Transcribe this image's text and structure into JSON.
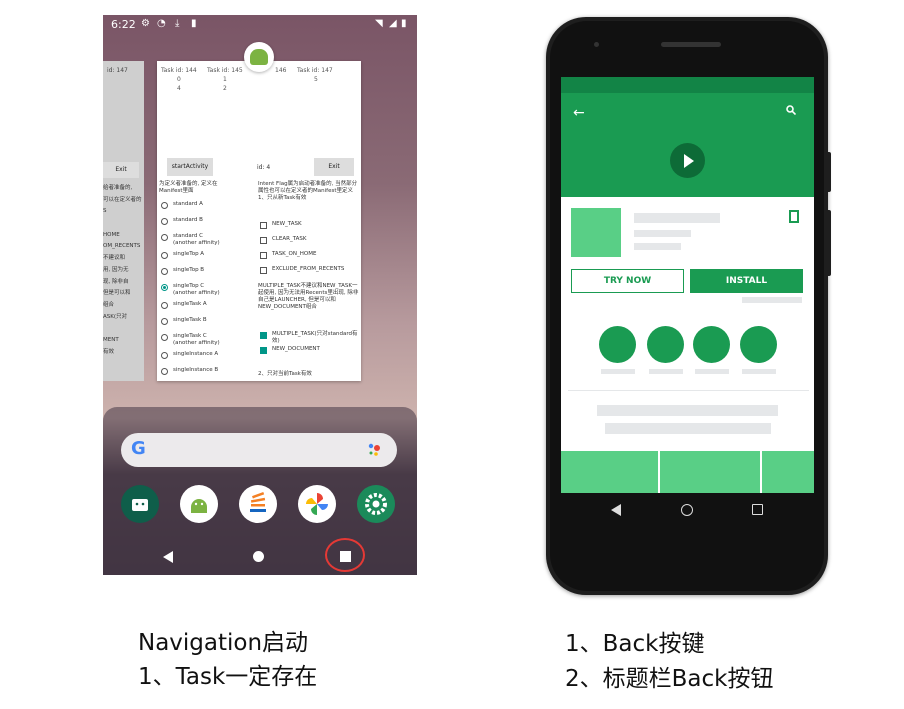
{
  "left_screen": {
    "status_time": "6:22",
    "recents_card": {
      "task_ids": [
        "Task id: 144",
        "Task id: 145",
        "146",
        "Task id: 147"
      ],
      "row1": [
        "0",
        "1",
        "",
        "5"
      ],
      "row2": [
        "4",
        "2"
      ],
      "left_card_text": "id: 147",
      "left_exit": "Exit",
      "start_activity": "startActivity",
      "id_label": "id: 4",
      "exit": "Exit",
      "left_col_intro": "为定义者准备的, 定义在Manifest里面",
      "left_col_modes": [
        "standard A",
        "standard B",
        "standard C\n(another affinity)",
        "singleTop A",
        "singleTop B",
        "singleTop C\n(another affinity)",
        "singleTask A",
        "singleTask B",
        "singleTask C\n(another affinity)",
        "singleInstance A",
        "singleInstance B"
      ],
      "right_col_intro": "Intent Flag属为启动者准备的, 当然部分属性也可以在定义者的Manifest里定义\n1、只从新Task有效",
      "right_col_flags": [
        {
          "label": "NEW_TASK",
          "checked": false
        },
        {
          "label": "CLEAR_TASK",
          "checked": false
        },
        {
          "label": "TASK_ON_HOME",
          "checked": false
        },
        {
          "label": "EXCLUDE_FROM_RECENTS",
          "checked": false
        }
      ],
      "right_col_note": "MULTIPLE_TASK不建议和NEW_TASK一起使用, 因为无法用Recents里出现, 除非自己是LAUNCHER, 但是可以和NEW_DOCUMENT组合",
      "right_col_flags2": [
        {
          "label": "MULTIPLE_TASK(只对standard有效)",
          "checked": true
        },
        {
          "label": "NEW_DOCUMENT",
          "checked": true
        }
      ],
      "right_col_footer": "2、只对当前Task有效",
      "left_partial_lines": [
        "给者准备的,",
        "可以在定义者的",
        "S",
        "",
        "HOME",
        "OM_RECENTS",
        "不建议和",
        "用, 因为无",
        "现, 除非自",
        "但是可以和",
        "组合",
        "ASK(只对",
        "",
        "MENT",
        "有效"
      ]
    },
    "search_logo": "G",
    "colors": {
      "accent": "#009688",
      "highlight_circle": "#e53935"
    }
  },
  "right_screen": {
    "try_now": "TRY NOW",
    "install": "INSTALL",
    "colors": {
      "primary": "#1a9b52",
      "primary_dark": "#128446",
      "light": "#59cf86"
    }
  },
  "captions": {
    "left": [
      "Navigation启动",
      "1、Task一定存在"
    ],
    "right": [
      "1、Back按键",
      "2、标题栏Back按钮"
    ]
  }
}
